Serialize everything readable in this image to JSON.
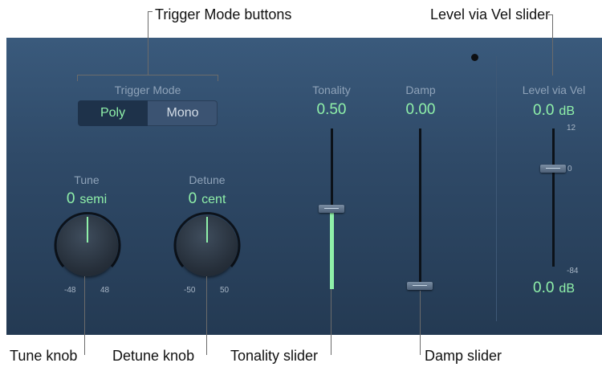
{
  "callouts": {
    "trigger_mode_buttons": "Trigger Mode buttons",
    "level_via_vel_slider": "Level via Vel slider",
    "tune_knob": "Tune knob",
    "detune_knob": "Detune knob",
    "tonality_slider": "Tonality slider",
    "damp_slider": "Damp slider"
  },
  "trigger_mode": {
    "label": "Trigger Mode",
    "options": [
      "Poly",
      "Mono"
    ],
    "selected": "Poly"
  },
  "tune": {
    "label": "Tune",
    "value": "0",
    "unit": "semi",
    "min_label": "-48",
    "max_label": "48"
  },
  "detune": {
    "label": "Detune",
    "value": "0",
    "unit": "cent",
    "min_label": "-50",
    "max_label": "50"
  },
  "tonality": {
    "label": "Tonality",
    "value": "0.50",
    "level": 0.5
  },
  "damp": {
    "label": "Damp",
    "value": "0.00",
    "level": 0.0
  },
  "level_via_vel": {
    "label": "Level via Vel",
    "top_value": "0.0",
    "top_unit": "dB",
    "bottom_value": "0.0",
    "bottom_unit": "dB",
    "scale_top": "12",
    "scale_mid": "0",
    "scale_bottom": "-84"
  },
  "colors": {
    "accent_green": "#8ff0a9",
    "panel_top": "#3a5a7c",
    "panel_bottom": "#243a53"
  }
}
